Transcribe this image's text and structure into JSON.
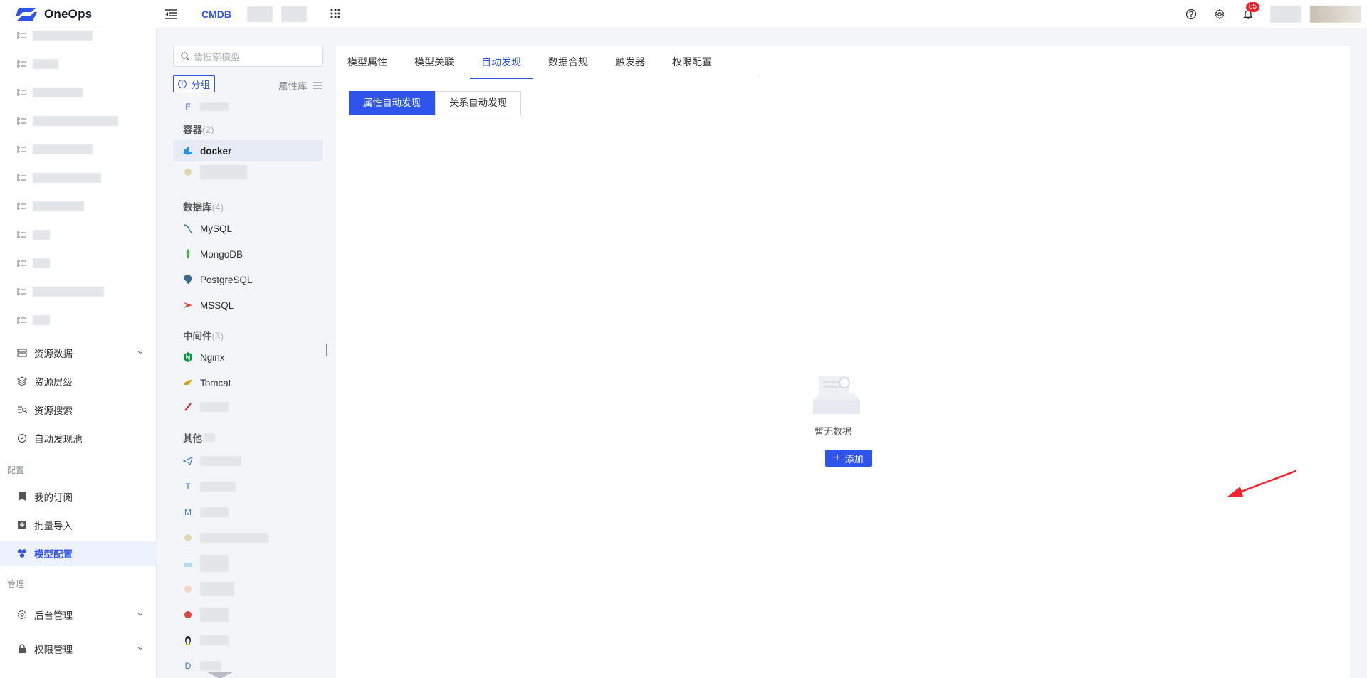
{
  "app": {
    "name": "OneOps",
    "module": "CMDB",
    "notification_count": "85"
  },
  "header": {
    "icons": [
      "help-icon",
      "settings-icon",
      "bell-icon"
    ]
  },
  "sidebar": {
    "items": [
      {
        "label": "资源数据",
        "icon": "server-icon",
        "has_children": true
      },
      {
        "label": "资源层级",
        "icon": "layers-icon"
      },
      {
        "label": "资源搜索",
        "icon": "search-list-icon"
      },
      {
        "label": "自动发现池",
        "icon": "compass-icon"
      }
    ],
    "section_config": "配置",
    "config_items": [
      {
        "label": "我的订阅",
        "icon": "bookmark-icon"
      },
      {
        "label": "批量导入",
        "icon": "import-icon"
      },
      {
        "label": "模型配置",
        "icon": "cubes-icon",
        "active": true
      }
    ],
    "section_manage": "管理",
    "manage_items": [
      {
        "label": "后台管理",
        "icon": "gear-icon",
        "has_children": true
      },
      {
        "label": "权限管理",
        "icon": "lock-icon",
        "has_children": true
      }
    ]
  },
  "model_panel": {
    "search_placeholder": "请搜索模型",
    "group_button": "分组",
    "attr_lib": "属性库",
    "categories": [
      {
        "name": "容器",
        "count": "(2)"
      },
      {
        "name": "数据库",
        "count": "(4)"
      },
      {
        "name": "中间件",
        "count": "(3)"
      },
      {
        "name": "其他",
        "count": ""
      }
    ],
    "models": {
      "docker": "docker",
      "mysql": "MySQL",
      "mongodb": "MongoDB",
      "postgresql": "PostgreSQL",
      "mssql": "MSSQL",
      "nginx": "Nginx",
      "tomcat": "Tomcat"
    },
    "other_letters": [
      "T",
      "M",
      "D"
    ]
  },
  "main": {
    "tabs": [
      "模型属性",
      "模型关联",
      "自动发现",
      "数据合规",
      "触发器",
      "权限配置"
    ],
    "active_tab": "自动发现",
    "subtabs": [
      "属性自动发现",
      "关系自动发现"
    ],
    "active_subtab": "属性自动发现",
    "empty_text": "暂无数据",
    "add_button": "添加"
  },
  "colors": {
    "primary": "#2f54eb",
    "annotation_arrow": "#f5222d"
  }
}
